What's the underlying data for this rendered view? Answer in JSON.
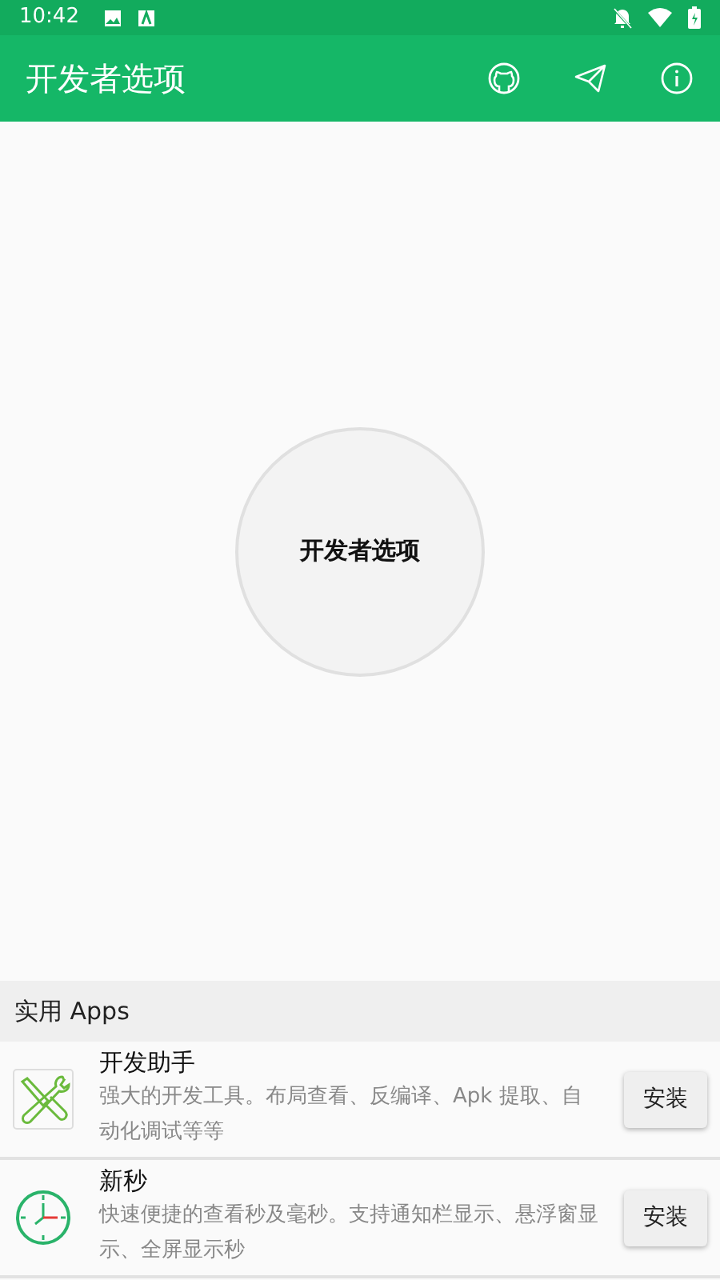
{
  "status_bar": {
    "time": "10:42"
  },
  "app_bar": {
    "title": "开发者选项"
  },
  "main_button": {
    "label": "开发者选项"
  },
  "section": {
    "title": "实用 Apps"
  },
  "apps": [
    {
      "kind": "tools",
      "name": "开发助手",
      "description": "强大的开发工具。布局查看、反编译、Apk 提取、自动化调试等等",
      "button": "安装"
    },
    {
      "kind": "clock",
      "name": "新秒",
      "description": "快速便捷的查看秒及毫秒。支持通知栏显示、悬浮窗显示、全屏显示秒",
      "button": "安装"
    }
  ]
}
